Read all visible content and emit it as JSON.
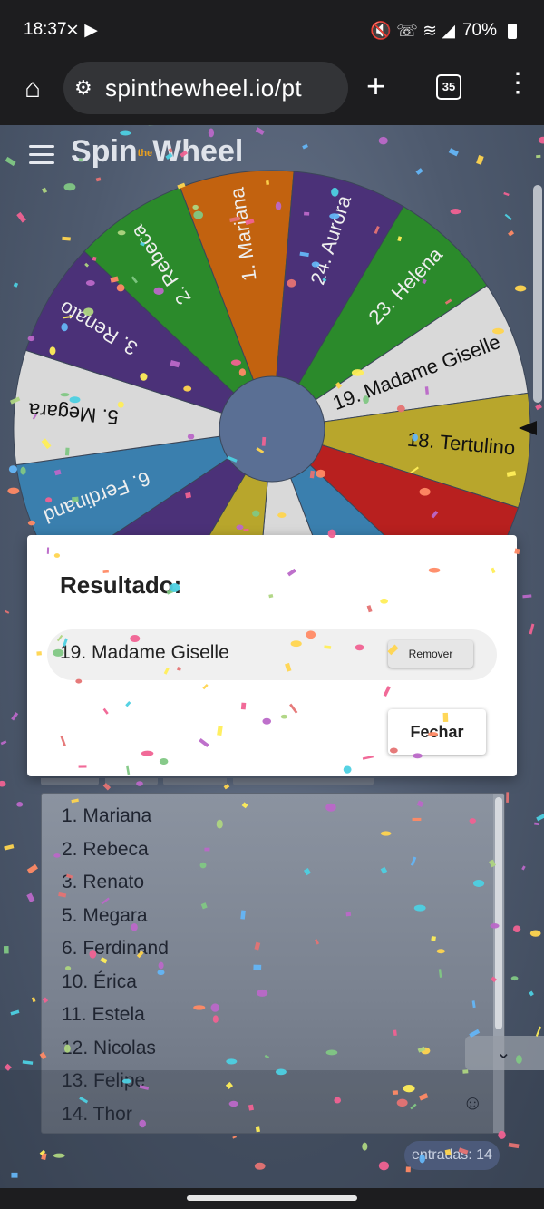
{
  "status_bar": {
    "time": "18:37",
    "notif_icons": "⨯ ▶",
    "right_icons": "🔇 ☏ ≋ ◢",
    "battery": "70%"
  },
  "browser": {
    "url": "spinthewheel.io/pt",
    "tab_count": "35"
  },
  "app": {
    "logo": "Spin Wheel",
    "logo_small": "the"
  },
  "wheel": {
    "segments": [
      {
        "label": "1. Mariana",
        "color": "#c2620f"
      },
      {
        "label": "24. Aurora",
        "color": "#4b3178"
      },
      {
        "label": "23. Helena",
        "color": "#2b8a2b"
      },
      {
        "label": "19. Madame Giselle",
        "color": "#d9d9d9"
      },
      {
        "label": "18. Tertulino",
        "color": "#b8a62c"
      },
      {
        "label": "",
        "color": "#b8201f"
      },
      {
        "label": "",
        "color": "#3a7fae"
      },
      {
        "label": "",
        "color": "#d9d9d9"
      },
      {
        "label": "",
        "color": "#b8a62c"
      },
      {
        "label": "",
        "color": "#4b3178"
      },
      {
        "label": "6. Ferdinand",
        "color": "#3a7fae"
      },
      {
        "label": "5. Megara",
        "color": "#d9d9d9"
      },
      {
        "label": "3. Renato",
        "color": "#4b3178"
      },
      {
        "label": "2. Rebeca",
        "color": "#2b8a2b"
      }
    ]
  },
  "dialog": {
    "title": "Resultado:",
    "result": "19. Madame Giselle",
    "remove_label": "Remover",
    "close_label": "Fechar"
  },
  "entries": [
    "1. Mariana",
    "2. Rebeca",
    "3. Renato",
    "5. Megara",
    "6. Ferdinand",
    "10. Érica",
    "11. Estela",
    "12. Nicolas",
    "13. Felipe",
    "14. Thor"
  ],
  "entries_count": "entradas: 14",
  "icons": {
    "home": "home-icon",
    "tune": "tune-icon",
    "plus": "plus-icon",
    "menu": "more-vert-icon",
    "emoji": "emoji-icon",
    "chevron": "chevron-down-icon"
  }
}
